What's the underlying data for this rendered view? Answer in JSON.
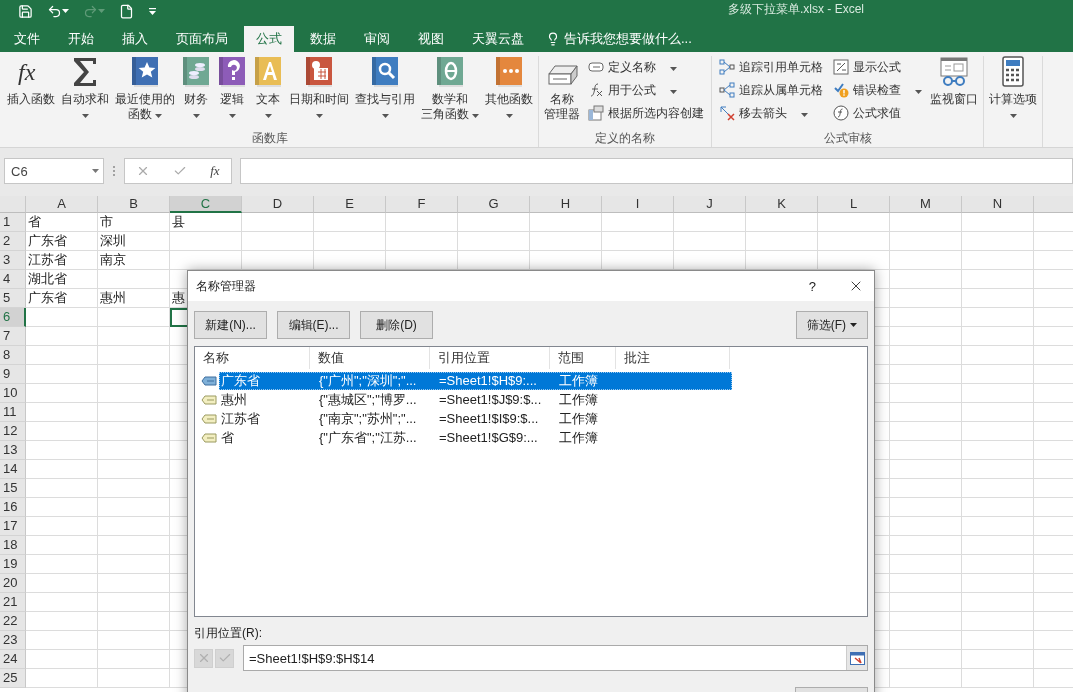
{
  "window": {
    "title": "多级下拉菜单.xlsx - Excel"
  },
  "quick_access": [
    {
      "kind": "save",
      "disabled": false
    },
    {
      "kind": "undo",
      "disabled": false
    },
    {
      "kind": "redo",
      "disabled": true
    },
    {
      "kind": "new",
      "disabled": false
    },
    {
      "kind": "customize",
      "disabled": false
    }
  ],
  "tabs": [
    {
      "label": "文件",
      "selected": false
    },
    {
      "label": "开始",
      "selected": false
    },
    {
      "label": "插入",
      "selected": false
    },
    {
      "label": "页面布局",
      "selected": false
    },
    {
      "label": "公式",
      "selected": true
    },
    {
      "label": "数据",
      "selected": false
    },
    {
      "label": "审阅",
      "selected": false
    },
    {
      "label": "视图",
      "selected": false
    },
    {
      "label": "天翼云盘",
      "selected": false
    }
  ],
  "tell_me": {
    "placeholder": "告诉我您想要做什么..."
  },
  "ribbon": {
    "groups": [
      {
        "label": "函数库",
        "items": [
          {
            "kind": "large",
            "symbol": "fx",
            "lines": [
              "插入函数"
            ],
            "dropdown": false
          },
          {
            "kind": "large",
            "lines": [
              "自动求和"
            ],
            "dropdown": true
          },
          {
            "kind": "large",
            "color": "#3f6fb3",
            "lines": [
              "最近使用的",
              "函数"
            ],
            "dropdown": true
          },
          {
            "kind": "large",
            "color": "#6fa893",
            "lines": [
              "财务"
            ],
            "dropdown": true
          },
          {
            "kind": "large",
            "color": "#8d5cb8",
            "lines": [
              "逻辑"
            ],
            "dropdown": true
          },
          {
            "kind": "large",
            "color": "#e9bd55",
            "lines": [
              "文本"
            ],
            "dropdown": true
          },
          {
            "kind": "large",
            "color": "#c9563f",
            "lines": [
              "日期和时间"
            ],
            "dropdown": true
          },
          {
            "kind": "large",
            "color": "#3f7dc0",
            "lines": [
              "查找与引用"
            ],
            "dropdown": true
          },
          {
            "kind": "large",
            "color": "#6fa893",
            "lines": [
              "数学和",
              "三角函数"
            ],
            "dropdown": true
          },
          {
            "kind": "large",
            "color": "#e4873d",
            "lines": [
              "其他函数"
            ],
            "dropdown": true
          }
        ]
      },
      {
        "label": "定义的名称",
        "items": [
          {
            "kind": "large",
            "lines": [
              "名称",
              "管理器"
            ],
            "dropdown": false
          },
          {
            "kind": "column",
            "items": [
              {
                "label": "定义名称",
                "dropdown": true
              },
              {
                "label": "用于公式",
                "dropdown": true
              },
              {
                "label": "根据所选内容创建",
                "dropdown": false
              }
            ]
          }
        ]
      },
      {
        "label": "公式审核",
        "items": [
          {
            "kind": "column",
            "items": [
              {
                "label": "追踪引用单元格",
                "dropdown": false
              },
              {
                "label": "追踪从属单元格",
                "dropdown": false
              },
              {
                "label": "移去箭头",
                "dropdown": true
              }
            ]
          },
          {
            "kind": "column",
            "items": [
              {
                "label": "显示公式",
                "dropdown": false
              },
              {
                "label": "错误检查",
                "dropdown": true
              },
              {
                "label": "公式求值",
                "dropdown": false
              }
            ]
          },
          {
            "kind": "large",
            "lines": [
              "监视窗口"
            ],
            "dropdown": false
          }
        ]
      },
      {
        "items": [
          {
            "kind": "large",
            "lines": [
              "计算选项"
            ],
            "dropdown": true
          }
        ]
      }
    ]
  },
  "formula_bar": {
    "name_box": "C6",
    "function_symbol": "fx"
  },
  "sheet": {
    "columns": [
      {
        "label": "A",
        "selected": false
      },
      {
        "label": "B",
        "selected": false
      },
      {
        "label": "C",
        "selected": true
      },
      {
        "label": "D",
        "selected": false
      },
      {
        "label": "E",
        "selected": false
      },
      {
        "label": "F",
        "selected": false
      },
      {
        "label": "G",
        "selected": false
      },
      {
        "label": "H",
        "selected": false
      },
      {
        "label": "I",
        "selected": false
      },
      {
        "label": "J",
        "selected": false
      },
      {
        "label": "K",
        "selected": false
      },
      {
        "label": "L",
        "selected": false
      },
      {
        "label": "M",
        "selected": false
      },
      {
        "label": "N",
        "selected": false
      }
    ],
    "rows": [
      {
        "label": "1",
        "selected": false,
        "cells": [
          "省",
          "市",
          "县"
        ]
      },
      {
        "label": "2",
        "selected": false,
        "cells": [
          "广东省",
          "深圳"
        ]
      },
      {
        "label": "3",
        "selected": false,
        "cells": [
          "江苏省",
          "南京"
        ]
      },
      {
        "label": "4",
        "selected": false,
        "cells": [
          "湖北省"
        ]
      },
      {
        "label": "5",
        "selected": false,
        "cells": [
          "广东省",
          "惠州",
          "惠"
        ]
      },
      {
        "label": "6",
        "selected": true
      },
      {
        "label": "7",
        "selected": false
      },
      {
        "label": "8",
        "selected": false
      },
      {
        "label": "9",
        "selected": false
      },
      {
        "label": "10",
        "selected": false
      },
      {
        "label": "11",
        "selected": false
      },
      {
        "label": "12",
        "selected": false
      },
      {
        "label": "13",
        "selected": false
      },
      {
        "label": "14",
        "selected": false
      },
      {
        "label": "15",
        "selected": false
      },
      {
        "label": "16",
        "selected": false
      },
      {
        "label": "17",
        "selected": false
      },
      {
        "label": "18",
        "selected": false
      },
      {
        "label": "19",
        "selected": false
      },
      {
        "label": "20",
        "selected": false
      },
      {
        "label": "21",
        "selected": false
      },
      {
        "label": "22",
        "selected": false
      },
      {
        "label": "23",
        "selected": false
      },
      {
        "label": "24",
        "selected": false
      },
      {
        "label": "25",
        "selected": false
      }
    ]
  },
  "dialog": {
    "title": "名称管理器",
    "help": "?",
    "buttons": [
      "新建(N)...",
      "编辑(E)...",
      "删除(D)"
    ],
    "filter_button": "筛选(F)",
    "columns": [
      "名称",
      "数值",
      "引用位置",
      "范围",
      "批注"
    ],
    "rows": [
      {
        "name": "广东省",
        "value": "{\"广州\";\"深圳\";\"...",
        "refers_to": "=Sheet1!$H$9:...",
        "scope": "工作簿",
        "selected": true
      },
      {
        "name": "惠州",
        "value": "{\"惠城区\";\"博罗...",
        "refers_to": "=Sheet1!$J$9:$...",
        "scope": "工作簿",
        "selected": false
      },
      {
        "name": "江苏省",
        "value": "{\"南京\";\"苏州\";\"...",
        "refers_to": "=Sheet1!$I$9:$...",
        "scope": "工作簿",
        "selected": false
      },
      {
        "name": "省",
        "value": "{\"广东省\";\"江苏...",
        "refers_to": "=Sheet1!$G$9:...",
        "scope": "工作簿",
        "selected": false
      }
    ],
    "refers_to_label": "引用位置(R):",
    "refers_to_value": "=Sheet1!$H$9:$H$14"
  }
}
